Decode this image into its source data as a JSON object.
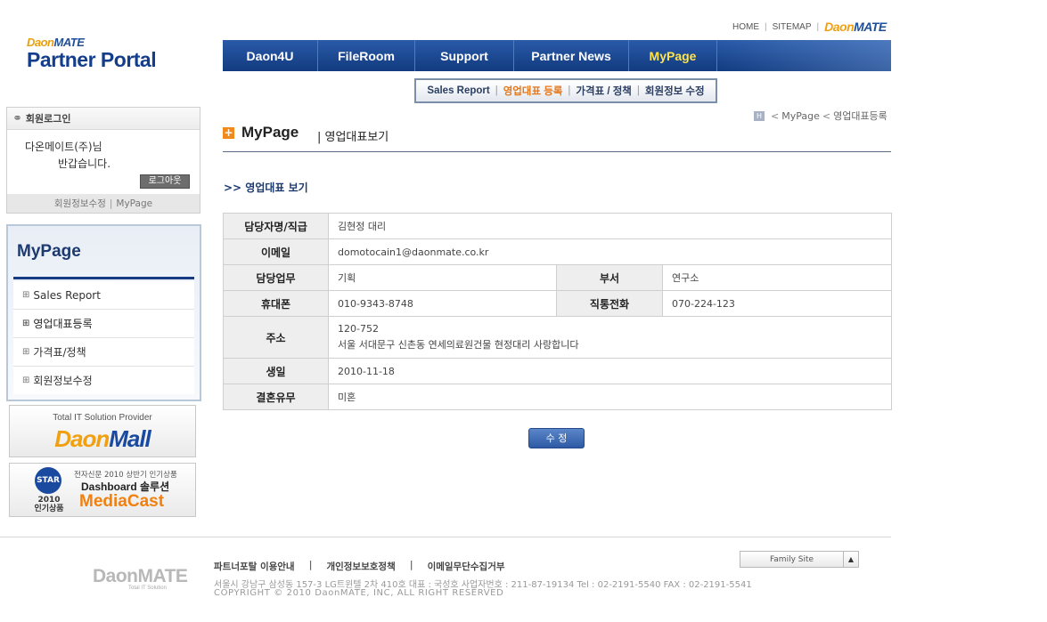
{
  "top_links": [
    "HOME",
    "SITEMAP"
  ],
  "brand_small": {
    "daon": "Daon",
    "mate": "MATE"
  },
  "logo": {
    "line1_a": "Daon",
    "line1_b": "MATE",
    "line2": "Partner Portal"
  },
  "nav": {
    "items": [
      "Daon4U",
      "FileRoom",
      "Support",
      "Partner News",
      "MyPage"
    ],
    "active": "MyPage"
  },
  "submenu": {
    "items": [
      "Sales Report",
      "영업대표 등록",
      "가격표 / 정책",
      "회원정보 수정"
    ],
    "active": "영업대표 등록"
  },
  "login": {
    "title": "회원로그인",
    "user": "다온메이트(주)님",
    "greeting": "반갑습니다.",
    "logout_label": "로그아웃",
    "footer_links": [
      "회원정보수정",
      "MyPage"
    ]
  },
  "side_menu": {
    "title": "MyPage",
    "items": [
      "Sales Report",
      "영업대표등록",
      "가격표/정책",
      "회원정보수정"
    ]
  },
  "banner1": {
    "tagline": "Total IT Solution Provider",
    "brand_a": "Daon",
    "brand_b": "Mall"
  },
  "banner2": {
    "badge": "STAR",
    "year": "2010",
    "year_sub": "인기상품",
    "desc": "전자신문 2010 상반기 인기상품",
    "product": "Dashboard 솔루션",
    "brand": "MediaCast"
  },
  "breadcrumb": {
    "home": "H",
    "items": [
      "MyPage",
      "영업대표등록"
    ]
  },
  "page": {
    "title": "MyPage",
    "subtitle": "| 영업대표보기",
    "section": ">> 영업대표 보기"
  },
  "info": {
    "name_label": "담당자명/직급",
    "name": "김현정 대리",
    "email_label": "이메일",
    "email": "domotocain1@daonmate.co.kr",
    "duty_label": "담당업무",
    "duty": "기획",
    "dept_label": "부서",
    "dept": "연구소",
    "mobile_label": "휴대폰",
    "mobile": "010-9343-8748",
    "direct_label": "직통전화",
    "direct": "070-224-123",
    "address_label": "주소",
    "zipcode": "120-752",
    "address": "서울 서대문구 신촌동 연세의료원건물 현정대리 사랑합니다",
    "birthday_label": "생일",
    "birthday": "2010-11-18",
    "married_label": "결혼유무",
    "married": "미혼"
  },
  "edit_label": "수 정",
  "footer": {
    "logo": "DaonMATE",
    "logo_sub": "Total IT Solution",
    "links": [
      "파트너포탈 이용안내",
      "개인정보보호정책",
      "이메일무단수집거부"
    ],
    "address": "서울시 강남구 삼성동 157-3 LG트윈텔 2차 410호    대표 : 국성호  사업자번호 : 211-87-19134    Tel : 02-2191-5540    FAX : 02-2191-5541",
    "copyright": "COPYRIGHT © 2010 DaonMATE, INC, ALL RIGHT RESERVED",
    "family_site": "Family Site"
  }
}
